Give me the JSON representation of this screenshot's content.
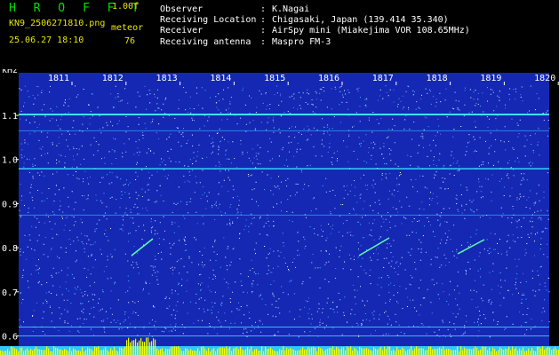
{
  "header": {
    "app_name": "H R O F F T",
    "version": "1.00f",
    "filename": "KN9_2506271810.png",
    "datetime": "25.06.27 18:10",
    "meteor_label": "meteor",
    "meteor_count": "76",
    "info": [
      {
        "key": "Observer",
        "value": "K.Nagai"
      },
      {
        "key": "Receiving Location",
        "value": "Chigasaki, Japan (139.414 35.340)"
      },
      {
        "key": "Receiver",
        "value": "AirSpy mini (Miakejima VOR 108.65MHz)"
      },
      {
        "key": "Receiving antenna",
        "value": "Maspro FM-3"
      }
    ]
  },
  "plot": {
    "y_unit": "kHz",
    "y_ticks": [
      "1.1",
      "1.0",
      "0.9",
      "0.8",
      "0.7",
      "0.6"
    ],
    "x_ticks": [
      "1811",
      "1812",
      "1813",
      "1814",
      "1815",
      "1816",
      "1817",
      "1818",
      "1819",
      "1820"
    ],
    "background_color": "#1428b4",
    "carrier_color": "#40e0ff",
    "meteor_color": "#60ffb0",
    "baseline_color": "#f0ff00"
  }
}
